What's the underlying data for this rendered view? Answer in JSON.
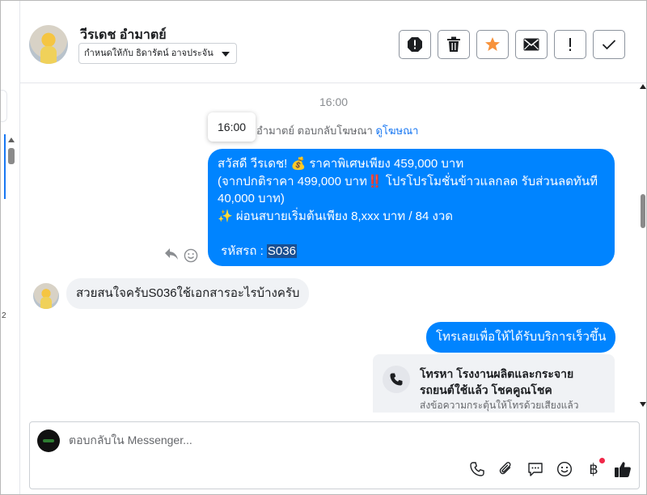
{
  "header": {
    "contact_name": "วีรเดช อำมาตย์",
    "assigned_to": "กำหนดให้กับ ธิดารัตน์ อาจประจัน",
    "actions": [
      {
        "name": "spam-icon",
        "label": "Mark as spam"
      },
      {
        "name": "trash-icon",
        "label": "Delete"
      },
      {
        "name": "star-icon",
        "label": "Star",
        "color": "#f7923b"
      },
      {
        "name": "envelope-icon",
        "label": "Mark as unread"
      },
      {
        "name": "exclamation-icon",
        "label": "Follow up"
      },
      {
        "name": "check-icon",
        "label": "Mark as done"
      }
    ]
  },
  "left_strip": {
    "number": "2"
  },
  "chat": {
    "timestamp": "16:00",
    "tooltip_time": "16:00",
    "reply_note_prefix": "อำมาตย์ ตอบกลับโฆษณา",
    "reply_note_link": "ดูโฆษณา",
    "main_message": {
      "line1": "สวัสดี วีรเดช! 💰 ราคาพิเศษเพียง 459,000 บาท",
      "line2": "(จากปกติราคา 499,000 บาท‼️ โปรโปรโมชั่นข้าวแลกลด รับส่วนลดทันที",
      "line3": "40,000 บาท)",
      "line4": "✨ ผ่อนสบายเริ่มต้นเพียง 8,xxx บาท / 84 งวด",
      "code_label": "รหัสรถ : ",
      "code_value": "S036"
    },
    "customer_message": "สวยสนใจครับS036ใช้เอกสารอะไรบ้างครับ",
    "cta_message": "โทรเลยเพื่อให้ได้รับบริการเร็วขึ้น",
    "call_card": {
      "title": "โทรหา โรงงานผลิตและกระจายรถยนต์ใช้แล้ว โชคคูณโชค",
      "subtitle": "ส่งข้อความกระตุ้นให้โทรด้วยเสียงแล้ว"
    }
  },
  "composer": {
    "placeholder": "ตอบกลับใน Messenger...",
    "tools": [
      "phone-icon",
      "paperclip-icon",
      "chat-bubble-icon",
      "smiley-icon",
      "baht-icon",
      "thumbs-up-icon"
    ],
    "baht_symbol": "฿",
    "colors": {
      "accent": "#1877f2",
      "bubble": "#0084ff",
      "notification_dot": "#f02849"
    }
  }
}
